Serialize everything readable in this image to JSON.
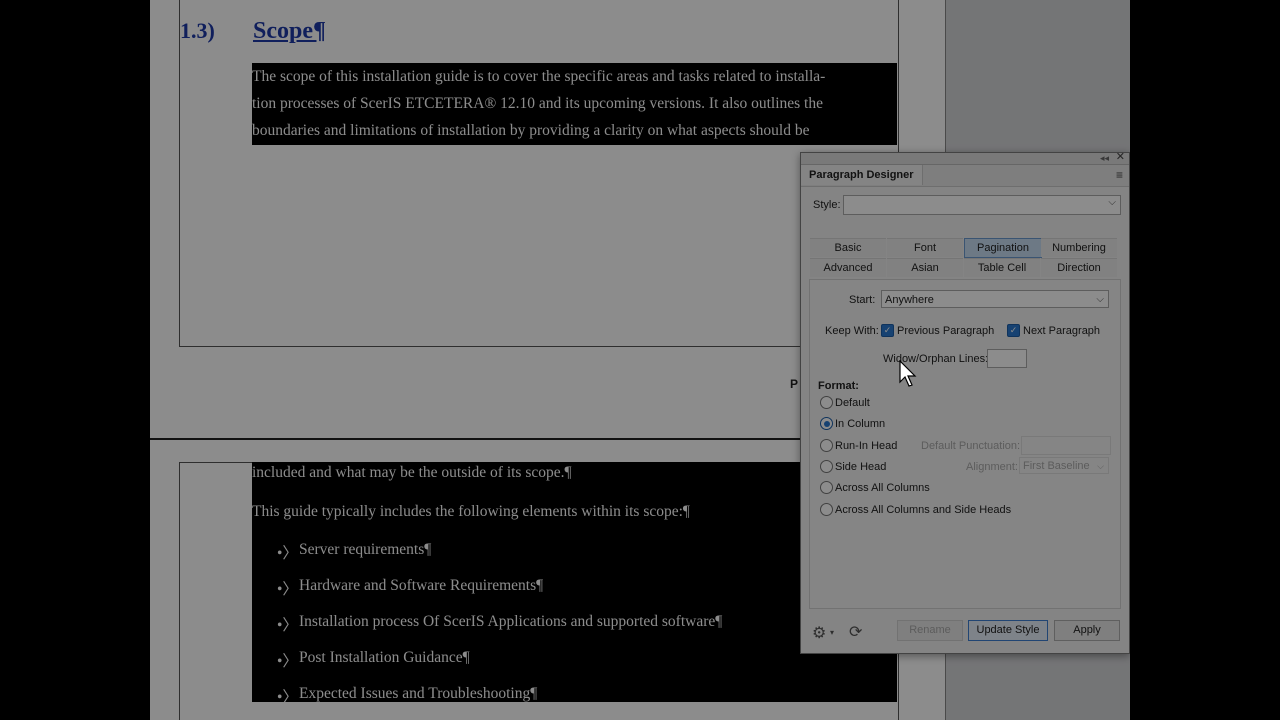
{
  "document": {
    "heading_number": "1.3)",
    "heading_title": "Scope¶",
    "page_fragment": "P",
    "paragraph1_lines": [
      "The scope of this installation guide is to cover the specific areas and tasks related to installa-",
      "tion processes of ScerIS ETCETERA® 12.10 and its upcoming versions. It also outlines the",
      "boundaries and limitations of installation by providing a clarity on what aspects should be"
    ],
    "paragraph2_line1": "included and what may be the outside of its scope.¶",
    "paragraph3": "This guide typically includes the following elements within its scope:¶",
    "bullet_marker": "•〉",
    "bullets": [
      "Server requirements¶",
      "Hardware and Software Requirements¶",
      "Installation process Of ScerIS Applications and supported software¶",
      "Post Installation Guidance¶",
      "Expected Issues and Troubleshooting¶"
    ]
  },
  "dialog": {
    "title": "Paragraph Designer",
    "style_label": "Style:",
    "style_value": "",
    "tabs": [
      "Basic",
      "Font",
      "Pagination",
      "Numbering",
      "Advanced",
      "Asian",
      "Table Cell",
      "Direction"
    ],
    "active_tab": "Pagination",
    "start_label": "Start:",
    "start_value": "Anywhere",
    "keep_with_label": "Keep With:",
    "previous_paragraph_label": "Previous Paragraph",
    "next_paragraph_label": "Next Paragraph",
    "previous_paragraph_checked": true,
    "next_paragraph_checked": true,
    "widow_orphan_label": "Widow/Orphan Lines:",
    "widow_orphan_value": "",
    "format_label": "Format:",
    "format_options": [
      "Default",
      "In Column",
      "Run-In Head",
      "Side Head",
      "Across All Columns",
      "Across All Columns and Side Heads"
    ],
    "format_selected": "In Column",
    "default_punctuation_label": "Default Punctuation:",
    "alignment_label": "Alignment:",
    "alignment_value": "First Baseline",
    "buttons": {
      "rename": "Rename",
      "update_style": "Update Style",
      "apply": "Apply"
    }
  },
  "colors": {
    "heading": "#1e3aa8",
    "selection_bg": "#000000",
    "active_tab": "#c7dcf2",
    "checkbox": "#2a78cf"
  }
}
